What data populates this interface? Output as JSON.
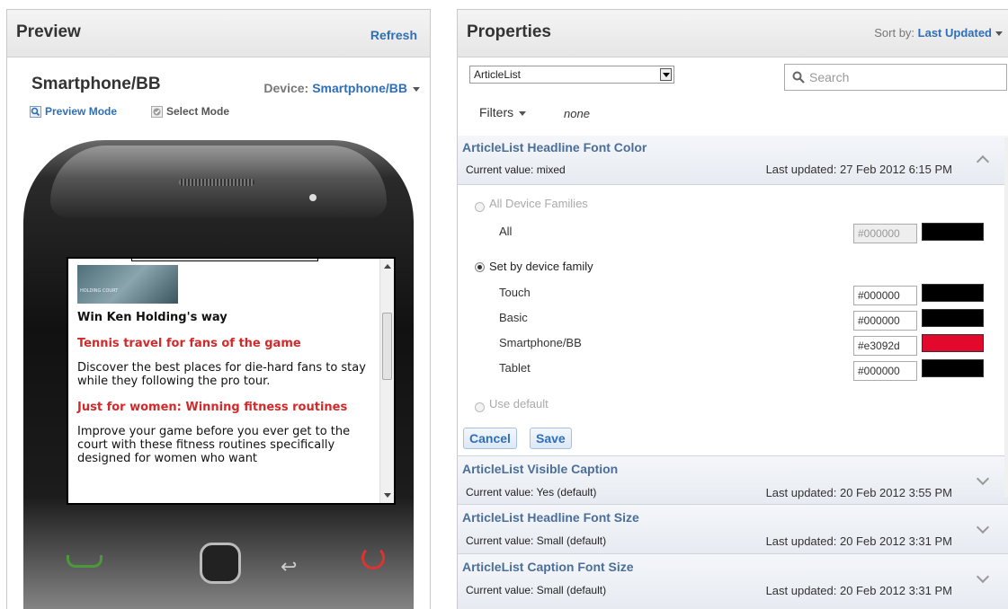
{
  "preview": {
    "title": "Preview",
    "refresh": "Refresh",
    "device_name": "Smartphone/BB",
    "device_label": "Device:",
    "device_value": "Smartphone/BB",
    "preview_mode": "Preview Mode",
    "select_mode": "Select Mode",
    "screen": {
      "image_caption": "HOLDING COURT",
      "headline": "Win Ken Holding's way",
      "article1_title": "Tennis travel for fans of the game",
      "article1_body": "Discover the best places for die-hard fans to stay while they following the pro tour.",
      "article2_title": "Just for women: Winning fitness routines",
      "article2_body": "Improve your game before you ever get to the court with these fitness routines specifically designed for women who want"
    }
  },
  "properties": {
    "title": "Properties",
    "sort_label": "Sort by:",
    "sort_value": "Last Updated",
    "list_select": "ArticleList",
    "search_placeholder": "Search",
    "filters_label": "Filters",
    "filters_value": "none",
    "items": [
      {
        "title": "ArticleList Headline Font Color",
        "current": "Current value: mixed",
        "updated": "Last updated: 27 Feb 2012 6:15 PM",
        "expanded": true
      },
      {
        "title": "ArticleList Visible Caption",
        "current": "Current value: Yes (default)",
        "updated": "Last updated: 20 Feb 2012 3:55 PM"
      },
      {
        "title": "ArticleList Headline Font Size",
        "current": "Current value: Small (default)",
        "updated": "Last updated: 20 Feb 2012 3:31 PM"
      },
      {
        "title": "ArticleList Caption Font Size",
        "current": "Current value: Small (default)",
        "updated": "Last updated: 20 Feb 2012 3:31 PM"
      }
    ],
    "editor": {
      "all_families": "All Device Families",
      "all": "All",
      "all_hex": "#000000",
      "by_family": "Set by device family",
      "families": [
        {
          "name": "Touch",
          "hex": "#000000",
          "color": "#000000"
        },
        {
          "name": "Basic",
          "hex": "#000000",
          "color": "#000000"
        },
        {
          "name": "Smartphone/BB",
          "hex": "#e3092d",
          "color": "#e3092d"
        },
        {
          "name": "Tablet",
          "hex": "#000000",
          "color": "#000000"
        }
      ],
      "use_default": "Use default",
      "cancel": "Cancel",
      "save": "Save"
    }
  },
  "colors": {
    "accent": "#2f6fb7",
    "item_title": "#4b6f98",
    "red": "#d22a2a"
  }
}
